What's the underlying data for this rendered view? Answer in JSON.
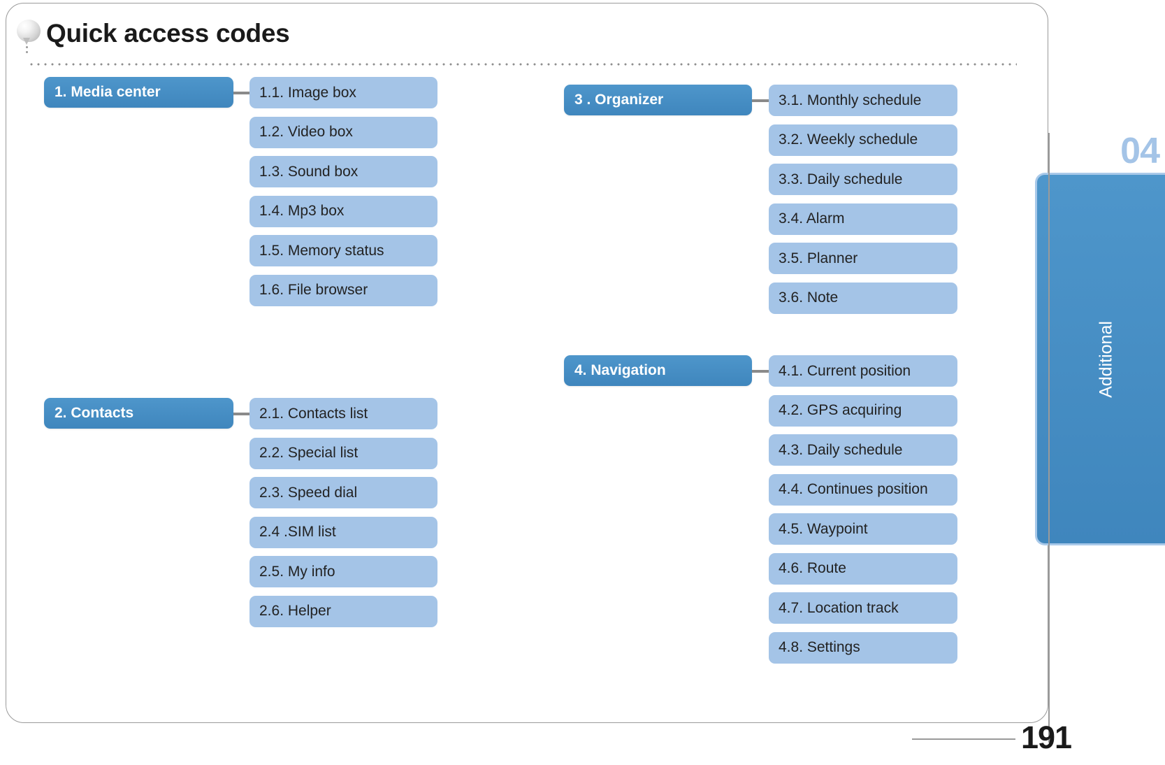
{
  "header": {
    "title": "Quick access codes",
    "bubble_icon": "speech-bubble-icon"
  },
  "sidebar": {
    "chapter_number": "04",
    "chapter_label": "Additional"
  },
  "footer": {
    "page_number": "191"
  },
  "colors": {
    "node_blue": "#4289bf",
    "leaf_blue": "#a4c4e7",
    "frame_gray": "#9a9a9a",
    "connector_gray": "#8a8a8a"
  },
  "groups": [
    {
      "id": "media-center",
      "head": "1. Media center",
      "items": [
        "1.1. Image box",
        "1.2. Video box",
        "1.3. Sound box",
        "1.4. Mp3 box",
        "1.5. Memory status",
        "1.6. File browser"
      ]
    },
    {
      "id": "contacts",
      "head": "2. Contacts",
      "items": [
        "2.1. Contacts list",
        "2.2. Special list",
        "2.3. Speed dial",
        "2.4 .SIM list",
        "2.5. My info",
        "2.6. Helper"
      ]
    },
    {
      "id": "organizer",
      "head": "3 . Organizer",
      "items": [
        "3.1. Monthly schedule",
        "3.2. Weekly schedule",
        "3.3. Daily schedule",
        "3.4. Alarm",
        "3.5. Planner",
        "3.6. Note"
      ]
    },
    {
      "id": "navigation",
      "head": "4. Navigation",
      "items": [
        "4.1. Current position",
        "4.2. GPS acquiring",
        "4.3. Daily schedule",
        "4.4. Continues position",
        "4.5. Waypoint",
        "4.6. Route",
        "4.7. Location track",
        "4.8. Settings"
      ]
    }
  ]
}
